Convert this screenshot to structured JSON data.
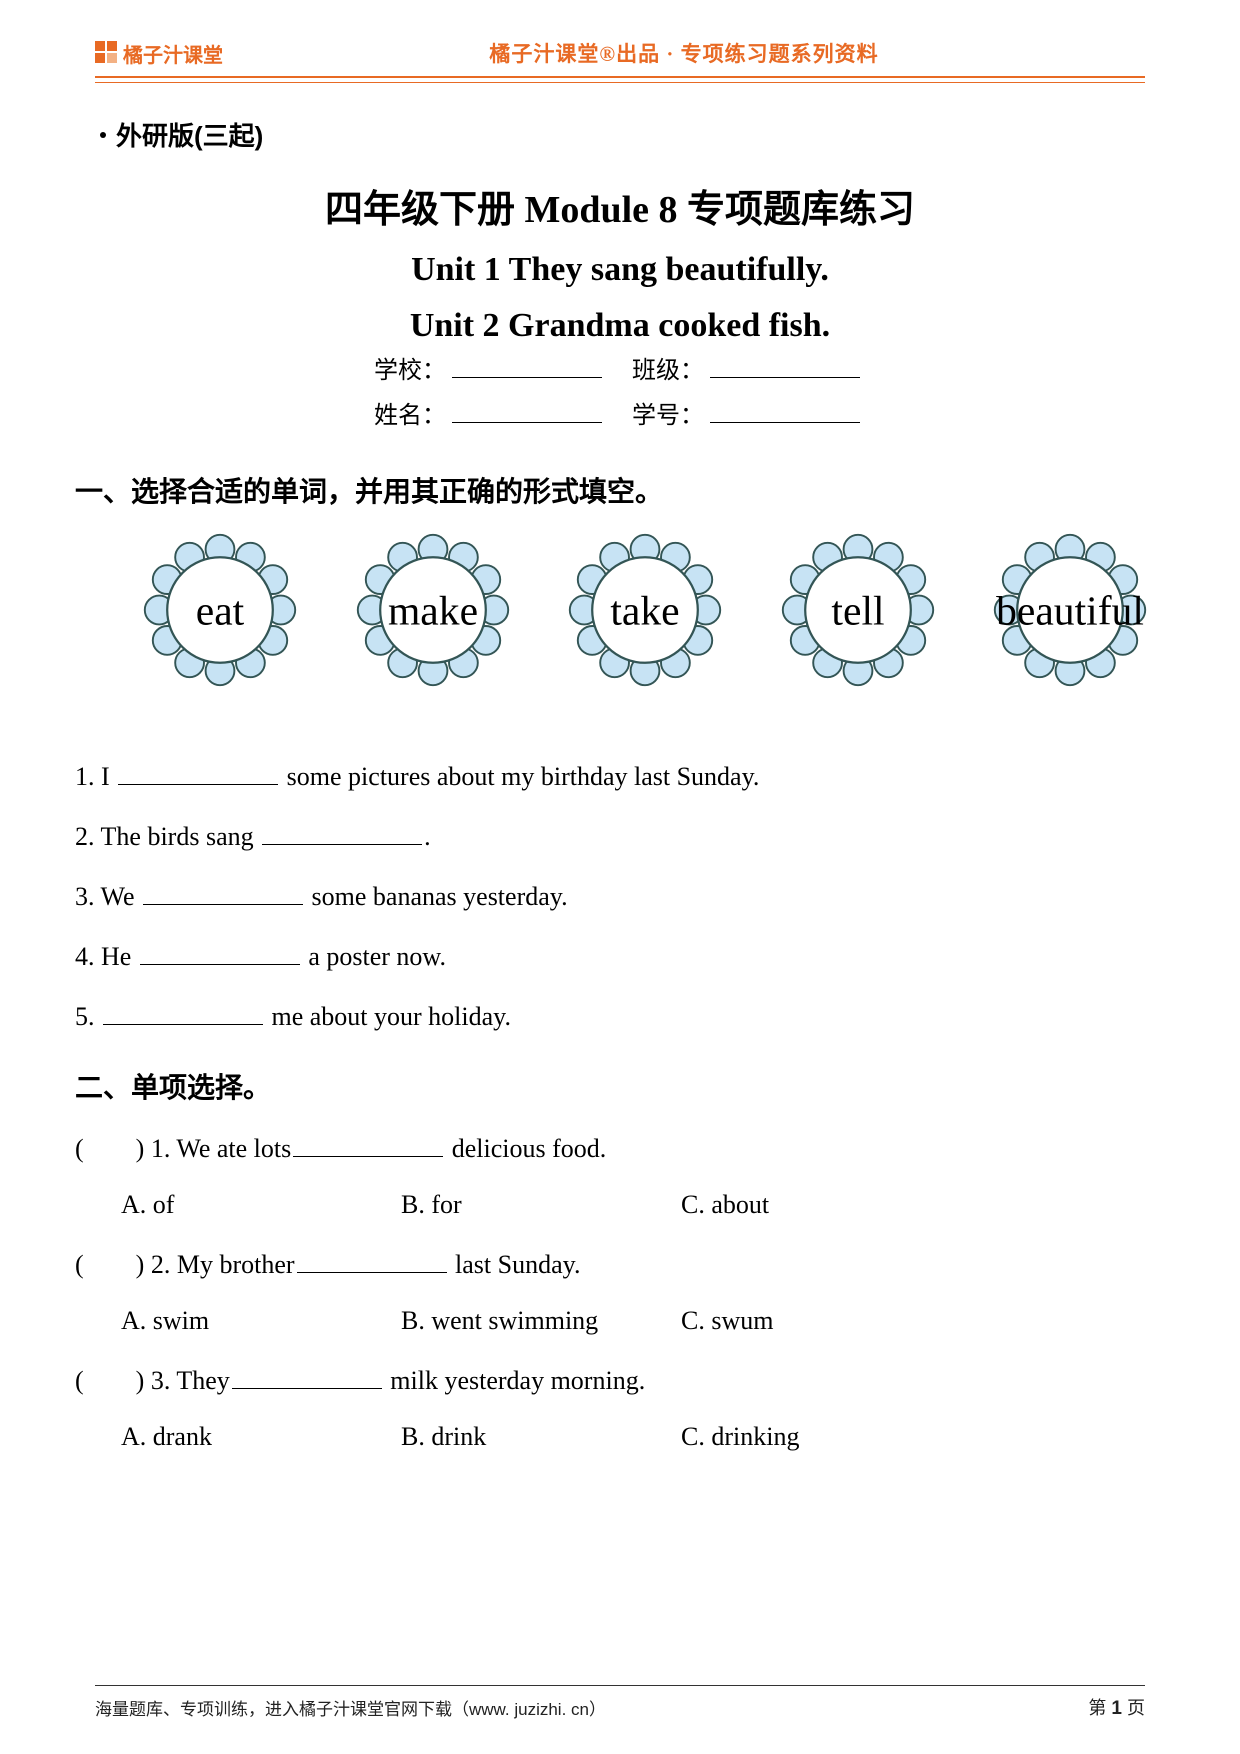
{
  "header": {
    "logo_text": "橘子汁课堂",
    "center_text": "橘子汁课堂®出品 · 专项练习题系列资料"
  },
  "edition": "外研版(三起)",
  "titles": {
    "module": "四年级下册 Module 8 专项题库练习",
    "unit1": "Unit 1 They sang beautifully.",
    "unit2": "Unit 2 Grandma cooked fish."
  },
  "info_labels": {
    "school": "学校：",
    "class": "班级：",
    "name": "姓名：",
    "number": "学号："
  },
  "section1": {
    "title": "一、选择合适的单词，并用其正确的形式填空。",
    "word_bank": [
      "eat",
      "make",
      "take",
      "tell",
      "beautiful"
    ],
    "items": [
      {
        "pre": "1. I ",
        "post": " some pictures about my birthday last Sunday."
      },
      {
        "pre": "2. The birds sang ",
        "post": "."
      },
      {
        "pre": "3. We ",
        "post": " some bananas yesterday."
      },
      {
        "pre": "4. He ",
        "post": " a poster now."
      },
      {
        "pre": "5. ",
        "post": " me about your holiday."
      }
    ]
  },
  "section2": {
    "title": "二、单项选择。",
    "items": [
      {
        "stem_pre": ") 1. We ate lots ",
        "stem_post": " delicious food.",
        "opts": {
          "A": "A. of",
          "B": "B. for",
          "C": "C. about"
        }
      },
      {
        "stem_pre": ") 2. My brother ",
        "stem_post": " last Sunday.",
        "opts": {
          "A": "A. swim",
          "B": "B. went swimming",
          "C": "C. swum"
        }
      },
      {
        "stem_pre": ") 3. They ",
        "stem_post": " milk yesterday morning.",
        "opts": {
          "A": "A. drank",
          "B": "B. drink",
          "C": "C. drinking"
        }
      }
    ]
  },
  "footer": {
    "left": "海量题库、专项训练，进入橘子汁课堂官网下载（www. juzizhi. cn）",
    "page_prefix": "第 ",
    "page_num": "1",
    "page_suffix": " 页"
  }
}
